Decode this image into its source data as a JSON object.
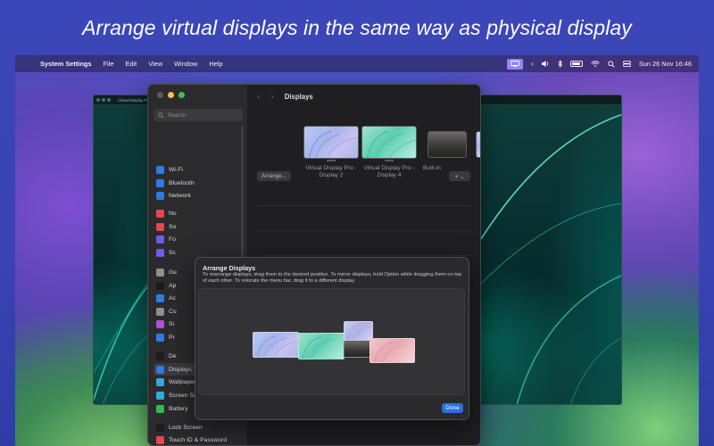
{
  "headline": "Arrange virtual displays in the same way as physical display",
  "menubar": {
    "app_name": "System Settings",
    "items": [
      "File",
      "Edit",
      "View",
      "Window",
      "Help"
    ],
    "clock": "Sun 26 Nov  16:46",
    "icons": [
      "display-mirror-icon",
      "chevron-left-icon",
      "volume-icon",
      "bluetooth-icon",
      "battery-icon",
      "wifi-icon",
      "search-icon",
      "control-center-icon"
    ]
  },
  "virtual_window_left": {
    "title": "Virtual Display Pro"
  },
  "settings": {
    "search_placeholder": "Search",
    "toolbar_title": "Displays",
    "sidebar": [
      {
        "label": "Wi-Fi",
        "icon": "wifi-icon",
        "color": "#2f7ae5"
      },
      {
        "label": "Bluetooth",
        "icon": "bluetooth-icon",
        "color": "#2f7ae5"
      },
      {
        "label": "Network",
        "icon": "globe-icon",
        "color": "#2f7ae5"
      },
      {
        "label": "No",
        "icon": "notifications-icon",
        "color": "#e5484d"
      },
      {
        "label": "So",
        "icon": "sound-icon",
        "color": "#e5484d"
      },
      {
        "label": "Fo",
        "icon": "focus-icon",
        "color": "#6e5ce6"
      },
      {
        "label": "Sc",
        "icon": "screen-time-icon",
        "color": "#6e5ce6"
      },
      {
        "label": "Ge",
        "icon": "gear-icon",
        "color": "#8e8e93"
      },
      {
        "label": "Ap",
        "icon": "appearance-icon",
        "color": "#1c1c1e"
      },
      {
        "label": "Ac",
        "icon": "accessibility-icon",
        "color": "#2f7ae5"
      },
      {
        "label": "Co",
        "icon": "control-centre-icon",
        "color": "#8e8e93"
      },
      {
        "label": "Si",
        "icon": "siri-icon",
        "color": "#b34fd6"
      },
      {
        "label": "Pr",
        "icon": "privacy-icon",
        "color": "#2f7ae5"
      },
      {
        "label": "De",
        "icon": "desktop-dock-icon",
        "color": "#1c1c1e"
      },
      {
        "label": "Displays",
        "icon": "displays-icon",
        "color": "#2f7ae5"
      },
      {
        "label": "Wallpaper",
        "icon": "wallpaper-icon",
        "color": "#34aadc"
      },
      {
        "label": "Screen Saver",
        "icon": "screen-saver-icon",
        "color": "#34aadc"
      },
      {
        "label": "Battery",
        "icon": "battery-icon",
        "color": "#30b94d"
      },
      {
        "label": "Lock Screen",
        "icon": "lock-icon",
        "color": "#1c1c1e"
      },
      {
        "label": "Touch ID & Password",
        "icon": "fingerprint-icon",
        "color": "#e5484d"
      }
    ],
    "selected": "Displays",
    "displays": [
      {
        "label": "Virtual Display Pro - Display 2"
      },
      {
        "label": "Virtual Display Pro - Display 4"
      },
      {
        "label": "Built-in"
      }
    ],
    "arrange_button": "Arrange...",
    "add_button": "+ ⌄"
  },
  "dialog": {
    "title": "Arrange Displays",
    "description": "To rearrange displays, drag them to the desired position. To mirror displays, hold Option while dragging them on top of each other. To relocate the menu bar, drag it to a different display.",
    "done_button": "Done"
  },
  "colors": {
    "accent": "#2a6fde",
    "traffic_close": "#5c5c60",
    "traffic_minimize": "#f5bf4f",
    "traffic_maximize": "#3cc24d",
    "menubar_active": "#8f86ff"
  }
}
